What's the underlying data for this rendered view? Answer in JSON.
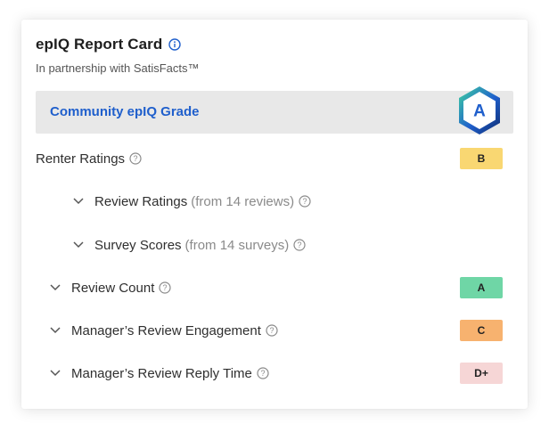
{
  "header": {
    "title": "epIQ Report Card",
    "info_icon": "info-icon",
    "subtitle": "In partnership with SatisFacts™"
  },
  "community_grade": {
    "label": "Community epIQ Grade",
    "grade": "A",
    "hex_colors": [
      "#3fd4a0",
      "#1f5fcc",
      "#0e2a6e"
    ]
  },
  "rows": [
    {
      "label": "Renter Ratings",
      "sub": "",
      "grade": "B",
      "badge_color": "#f9d772",
      "expandable": false,
      "indent": 0
    },
    {
      "label": "Review Ratings",
      "sub": "(from 14 reviews)",
      "grade": "",
      "badge_color": "",
      "expandable": true,
      "indent": 1
    },
    {
      "label": "Survey Scores",
      "sub": "(from 14 surveys)",
      "grade": "",
      "badge_color": "",
      "expandable": true,
      "indent": 1
    },
    {
      "label": "Review Count",
      "sub": "",
      "grade": "A",
      "badge_color": "#6fd6a6",
      "expandable": true,
      "indent": 0
    },
    {
      "label": "Manager’s Review Engagement",
      "sub": "",
      "grade": "C",
      "badge_color": "#f7b26f",
      "expandable": true,
      "indent": 0
    },
    {
      "label": "Manager’s Review Reply Time",
      "sub": "",
      "grade": "D+",
      "badge_color": "#f6d6d6",
      "expandable": true,
      "indent": 0
    }
  ],
  "colors": {
    "accent_blue": "#1f5fcc",
    "grade_row_bg": "#e8e8e8"
  }
}
